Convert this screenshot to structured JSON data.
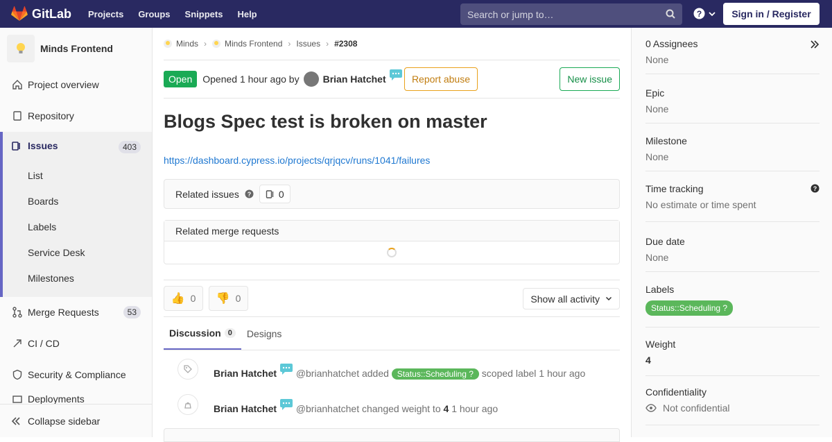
{
  "nav": {
    "brand": "GitLab",
    "links": [
      "Projects",
      "Groups",
      "Snippets",
      "Help"
    ],
    "search_placeholder": "Search or jump to…",
    "signin": "Sign in / Register"
  },
  "sidebar": {
    "project_name": "Minds Frontend",
    "items": {
      "overview": "Project overview",
      "repository": "Repository",
      "issues": "Issues",
      "issues_count": "403",
      "merge_requests": "Merge Requests",
      "mr_count": "53",
      "cicd": "CI / CD",
      "security": "Security & Compliance",
      "deploy_partial": "Deployments"
    },
    "sub_items": [
      "List",
      "Boards",
      "Labels",
      "Service Desk",
      "Milestones"
    ],
    "collapse": "Collapse sidebar"
  },
  "breadcrumb": [
    "Minds",
    "Minds Frontend",
    "Issues",
    "#2308"
  ],
  "issue": {
    "status": "Open",
    "opened_text": "Opened 1 hour ago by",
    "author": "Brian Hatchet",
    "report_abuse": "Report abuse",
    "new_issue": "New issue",
    "title": "Blogs Spec test is broken on master",
    "link": "https://dashboard.cypress.io/projects/qrjqcv/runs/1041/failures",
    "related_issues": "Related issues",
    "related_count": "0",
    "related_mrs": "Related merge requests",
    "thumbs_up": "0",
    "thumbs_down": "0",
    "activity_filter": "Show all activity"
  },
  "tabs": {
    "discussion": "Discussion",
    "discussion_count": "0",
    "designs": "Designs"
  },
  "notes": [
    {
      "author": "Brian Hatchet",
      "handle": "@brianhatchet added",
      "label": "Status::Scheduling",
      "suffix": "scoped label 1 hour ago"
    },
    {
      "author": "Brian Hatchet",
      "handle": "@brianhatchet changed weight to",
      "value": "4",
      "suffix": "1 hour ago"
    }
  ],
  "right_sidebar": {
    "assignees_title": "0 Assignees",
    "assignees_value": "None",
    "epic_title": "Epic",
    "epic_value": "None",
    "milestone_title": "Milestone",
    "milestone_value": "None",
    "time_title": "Time tracking",
    "time_value": "No estimate or time spent",
    "due_title": "Due date",
    "due_value": "None",
    "labels_title": "Labels",
    "label": "Status::Scheduling",
    "weight_title": "Weight",
    "weight_value": "4",
    "conf_title": "Confidentiality",
    "conf_value": "Not confidential"
  },
  "colors": {
    "nav_bg": "#292961",
    "accent": "#6666c4",
    "open": "#1aaa55",
    "label": "#5bb75b"
  }
}
